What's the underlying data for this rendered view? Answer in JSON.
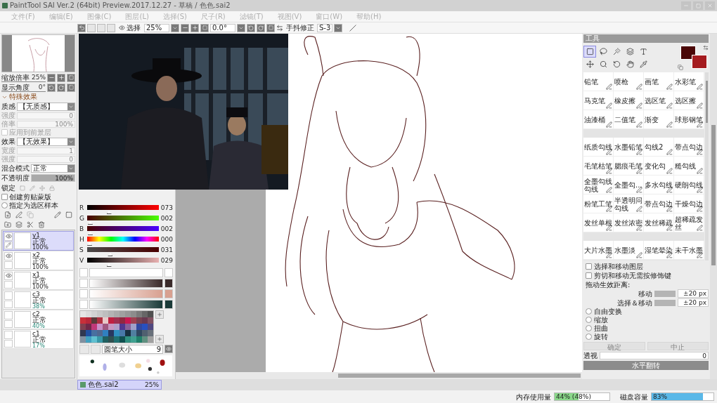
{
  "window": {
    "title": "PaintTool SAI Ver.2 (64bit) Preview.2017.12.27 - 草稿 / 色色.sai2"
  },
  "menu": [
    "文件(F)",
    "编辑(E)",
    "图像(C)",
    "图层(L)",
    "选择(S)",
    "尺子(R)",
    "滤镜(T)",
    "视图(V)",
    "窗口(W)",
    "帮助(H)"
  ],
  "toolbar": {
    "select_label": "选择",
    "zoom": "25%",
    "angle": "0.0°",
    "stabilizer_label": "手抖修正",
    "stabilizer": "S-3"
  },
  "navigator": {
    "zoom_label": "缩放倍率",
    "zoom": "25%",
    "angle_label": "显示角度",
    "angle": "0°"
  },
  "effects": {
    "title": "特殊效果",
    "expanded": true,
    "texture_label": "质感",
    "texture": "【无质感】",
    "texture_params": [
      {
        "label": "强度",
        "value": "0"
      },
      {
        "label": "倍率",
        "value": "100%"
      }
    ],
    "texture_option": {
      "label": "应用到前景层",
      "checked": false
    },
    "effect_label": "效果",
    "effect": "【无效果】",
    "effect_params": [
      {
        "label": "宽度",
        "value": "1"
      },
      {
        "label": "强度",
        "value": "0"
      }
    ]
  },
  "layer_props": {
    "blend_label": "混合模式",
    "blend": "正常",
    "opacity_label": "不透明度",
    "opacity": {
      "value": "100%",
      "level": 1
    },
    "lock_label": "锁定",
    "clip": {
      "label": "创建剪贴蒙版",
      "checked": false
    },
    "sample": {
      "label": "指定为选区样本",
      "checked": false
    }
  },
  "layers": [
    {
      "name": "y1",
      "mode": "正常",
      "opacity": "100%",
      "visible": true,
      "selected": true
    },
    {
      "name": "x2",
      "mode": "正常",
      "opacity": "100%",
      "visible": true,
      "selected": false
    },
    {
      "name": "x1",
      "mode": "正常",
      "opacity": "100%",
      "visible": true,
      "selected": false
    },
    {
      "name": "c3",
      "mode": "正常",
      "opacity": "38%",
      "visible": false,
      "selected": false
    },
    {
      "name": "c2",
      "mode": "正常",
      "opacity": "40%",
      "visible": false,
      "selected": false
    },
    {
      "name": "c1",
      "mode": "正常",
      "opacity": "17%",
      "visible": false,
      "selected": false
    }
  ],
  "color": {
    "sliders": [
      {
        "label": "R",
        "value": "073",
        "level": 0.29
      },
      {
        "label": "G",
        "value": "002",
        "level": 0.01
      },
      {
        "label": "B",
        "value": "002",
        "level": 0.01
      },
      {
        "label": "H",
        "value": "000",
        "level": 0
      },
      {
        "label": "S",
        "value": "031",
        "level": 0.31
      },
      {
        "label": "V",
        "value": "029",
        "level": 0.29
      }
    ],
    "swatches": [
      {
        "color": "#e6e6e6"
      },
      {
        "color": "#dcdcdc"
      },
      {
        "color": "#d2d2d2"
      },
      {
        "color": "#c8c8c8"
      },
      {
        "color": "#bebebe"
      },
      {
        "color": "#b4b4b4"
      },
      {
        "color": "#aaaaaa"
      },
      {
        "color": "#a0a0a0"
      },
      {
        "color": "#969696"
      },
      {
        "color": "#8c8c8c"
      },
      {
        "color": "#7a7a7a"
      },
      {
        "color": "#666666"
      },
      {
        "color": "#4f4f4f"
      },
      {
        "color": "#c8303a"
      },
      {
        "color": "#b8283a"
      },
      {
        "color": "#5a3a3a"
      },
      {
        "color": "#b03040"
      },
      {
        "color": "#e8c8c8"
      },
      {
        "color": "#c02040"
      },
      {
        "color": "#a03050"
      },
      {
        "color": "#902840"
      },
      {
        "color": "#c81850"
      },
      {
        "color": "#a04050"
      },
      {
        "color": "#784050"
      },
      {
        "color": "#6a3850"
      },
      {
        "color": "#805060"
      },
      {
        "color": "#804050"
      },
      {
        "color": "#702848"
      },
      {
        "color": "#c03878"
      },
      {
        "color": "#c890c8"
      },
      {
        "color": "#a05880"
      },
      {
        "color": "#c898c0"
      },
      {
        "color": "#b0a0c8"
      },
      {
        "color": "#503890"
      },
      {
        "color": "#886098"
      },
      {
        "color": "#a0a0c8"
      },
      {
        "color": "#3048a0"
      },
      {
        "color": "#2850c0"
      },
      {
        "color": "#504880"
      },
      {
        "color": "#303850"
      },
      {
        "color": "#2050a0"
      },
      {
        "color": "#4870a0"
      },
      {
        "color": "#506890"
      },
      {
        "color": "#3080c0"
      },
      {
        "color": "#283860"
      },
      {
        "color": "#3090c0"
      },
      {
        "color": "#4878a8"
      },
      {
        "color": "#183040"
      },
      {
        "color": "#5080a0"
      },
      {
        "color": "#304860"
      },
      {
        "color": "#506070"
      },
      {
        "color": "#68707a"
      },
      {
        "color": "#8090a0"
      },
      {
        "color": "#40a0c0"
      },
      {
        "color": "#60c0d0"
      },
      {
        "color": "#3898a8"
      },
      {
        "color": "#206060"
      },
      {
        "color": "#305050"
      },
      {
        "color": "#207070"
      },
      {
        "color": "#105050"
      },
      {
        "color": "#309080"
      },
      {
        "color": "#40a090"
      },
      {
        "color": "#20806a"
      },
      {
        "color": "#609080"
      },
      {
        "color": "#a0a0a0"
      }
    ],
    "brush_size_label": "圆笔大小",
    "brush_size": "9"
  },
  "tools_panel": {
    "title": "工具",
    "tools": [
      {
        "selected": true
      },
      {
        "selected": false
      },
      {
        "selected": false
      },
      {
        "selected": false
      },
      {
        "selected": false
      },
      {
        "selected": false
      },
      {
        "selected": false
      },
      {
        "selected": false
      },
      {
        "selected": false
      },
      {
        "selected": false
      }
    ],
    "colors": [
      {
        "color": "#4a0606"
      },
      {
        "color": "#a51c20"
      }
    ],
    "brush_groups": [
      [
        "铅笔",
        "喷枪",
        "画笔",
        "水彩笔",
        "马克笔",
        "橡皮擦",
        "选区笔",
        "选区擦",
        "油漆桶",
        "二值笔",
        "渐变",
        "球形钢笔"
      ],
      [
        "纸质勾线",
        "水墨铅笔",
        "勾线2",
        "带点勾边",
        "毛笔枯笔",
        "腮痕毛笔",
        "变化勾",
        "糙勾线",
        "全墨勾线勾线",
        "全墨勾...",
        "多水勾线",
        "硬朗勾线",
        "粉笔工笔",
        "半透明问勾线",
        "带点勾边",
        "干燥勾边",
        "发丝单根",
        "发丝浓密",
        "发丝稀疏",
        "超稀疏发丝"
      ],
      [
        "大片水墨",
        "水墨淡",
        "湿笔晕染",
        "未干水墨"
      ]
    ]
  },
  "move_options": {
    "checks": [
      {
        "label": "选择和移动图层",
        "checked": false
      },
      {
        "label": "剪切和移动无需按修饰键",
        "checked": false
      }
    ],
    "distance_label": "拖动生效距离:",
    "distances": [
      {
        "label": "移动",
        "value": "±20 px",
        "level": 1
      },
      {
        "label": "选择＆移动",
        "value": "±20 px",
        "level": 1
      }
    ],
    "modes": [
      {
        "label": "自由变换",
        "selected": false
      },
      {
        "label": "缩放",
        "selected": false
      },
      {
        "label": "扭曲",
        "selected": false
      },
      {
        "label": "旋转",
        "selected": false
      }
    ],
    "buttons": [
      {
        "label": "确定",
        "disabled": true
      },
      {
        "label": "中止",
        "disabled": true
      }
    ],
    "perspective_label": "透视",
    "perspective": "0",
    "flip": "水平翻转"
  },
  "file_tabs": [
    {
      "name": "色色.sai2",
      "zoom": "25%",
      "selected": true
    }
  ],
  "status": {
    "memory_label": "内存使用量",
    "memory": {
      "value": "44% (48%)",
      "level": 0.44
    },
    "disk_label": "磁盘容量",
    "disk": {
      "value": "83%",
      "level": 0.83
    }
  }
}
